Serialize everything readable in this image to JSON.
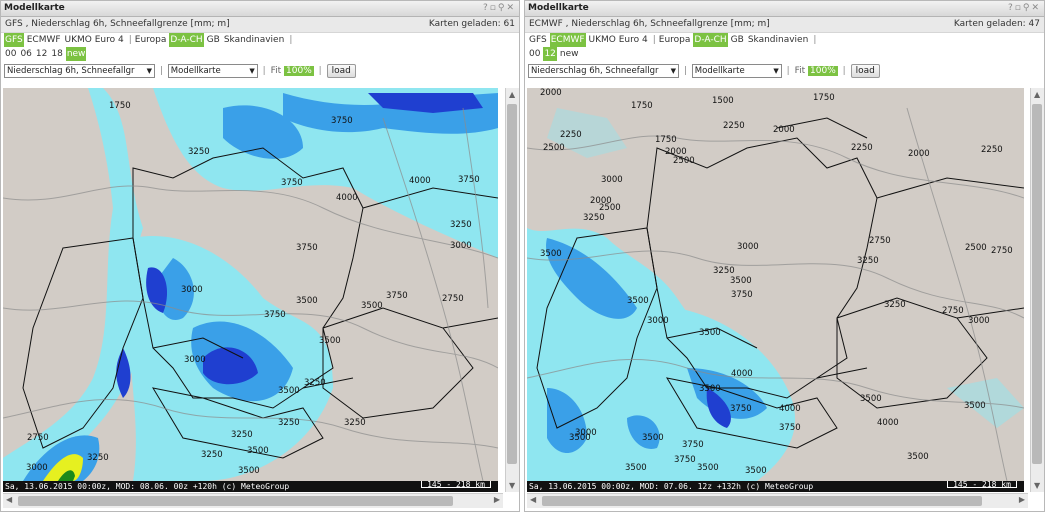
{
  "left": {
    "window_title": "Modellkarte",
    "info": "GFS , Niederschlag 6h, Schneefallgrenze [mm; m]",
    "loaded": "Karten geladen: 61",
    "models": [
      {
        "label": "GFS",
        "selected": true
      },
      {
        "label": "ECMWF",
        "selected": false
      },
      {
        "label": "UKMO Euro 4",
        "selected": false
      }
    ],
    "regions": [
      {
        "label": "Europa",
        "selected": false
      },
      {
        "label": "D-A-CH",
        "selected": true
      },
      {
        "label": "GB",
        "selected": false
      },
      {
        "label": "Skandinavien",
        "selected": false
      }
    ],
    "runs": [
      {
        "label": "00",
        "selected": false
      },
      {
        "label": "06",
        "selected": false
      },
      {
        "label": "12",
        "selected": false
      },
      {
        "label": "18",
        "selected": false
      },
      {
        "label": "new",
        "selected": true
      }
    ],
    "param_select": "Niederschlag 6h, Schneefallgr",
    "type_select": "Modellkarte",
    "fit_label": "Fit",
    "zoom": "100%",
    "load_label": "load",
    "status": "Sa, 13.06.2015 00:00z, MOD: 08.06. 00z +120h (c) MeteoGroup",
    "scale": "145 - 218 km",
    "contours": [
      "1750",
      "3750",
      "3250",
      "3750",
      "4000",
      "3750",
      "4000",
      "3250",
      "3000",
      "3750",
      "3000",
      "3500",
      "3750",
      "3500",
      "2750",
      "3750",
      "3500",
      "3250",
      "3500",
      "3250",
      "3250",
      "3250",
      "3500",
      "2750",
      "3250",
      "3000",
      "3250",
      "3500",
      "3000"
    ]
  },
  "right": {
    "window_title": "Modellkarte",
    "info": "ECMWF , Niederschlag 6h, Schneefallgrenze [mm; m]",
    "loaded": "Karten geladen: 47",
    "models": [
      {
        "label": "GFS",
        "selected": false
      },
      {
        "label": "ECMWF",
        "selected": true
      },
      {
        "label": "UKMO Euro 4",
        "selected": false
      }
    ],
    "regions": [
      {
        "label": "Europa",
        "selected": false
      },
      {
        "label": "D-A-CH",
        "selected": true
      },
      {
        "label": "GB",
        "selected": false
      },
      {
        "label": "Skandinavien",
        "selected": false
      }
    ],
    "runs": [
      {
        "label": "00",
        "selected": false
      },
      {
        "label": "12",
        "selected": true
      },
      {
        "label": "new",
        "selected": false
      }
    ],
    "param_select": "Niederschlag 6h, Schneefallgr",
    "type_select": "Modellkarte",
    "fit_label": "Fit",
    "zoom": "100%",
    "load_label": "load",
    "status": "Sa, 13.06.2015 00:00z, MOD: 07.06. 12z +132h (c) MeteoGroup",
    "scale": "145 - 218 km",
    "contours": [
      "2000",
      "1750",
      "1500",
      "1750",
      "2250",
      "2500",
      "2250",
      "2000",
      "1750",
      "2000",
      "2500",
      "2250",
      "2000",
      "2250",
      "3000",
      "2000",
      "2500",
      "3250",
      "3000",
      "3500",
      "2750",
      "3250",
      "2500",
      "2750",
      "3500",
      "3750",
      "3500",
      "3000",
      "3250",
      "3000",
      "3250",
      "2750",
      "3500",
      "3000",
      "3500",
      "4000",
      "3500",
      "3750",
      "4000",
      "3500",
      "3500",
      "4000",
      "3750",
      "3500",
      "3750",
      "3500",
      "3500",
      "3500",
      "3500",
      "3750"
    ]
  },
  "colors": {
    "selected": "#7cc242",
    "map_bg": "#d2ccc6",
    "precip_light": "#8fe6f0",
    "precip_mid": "#3aa0e8",
    "precip_dark": "#1f3fd0",
    "precip_deep": "#1a1aa0"
  }
}
